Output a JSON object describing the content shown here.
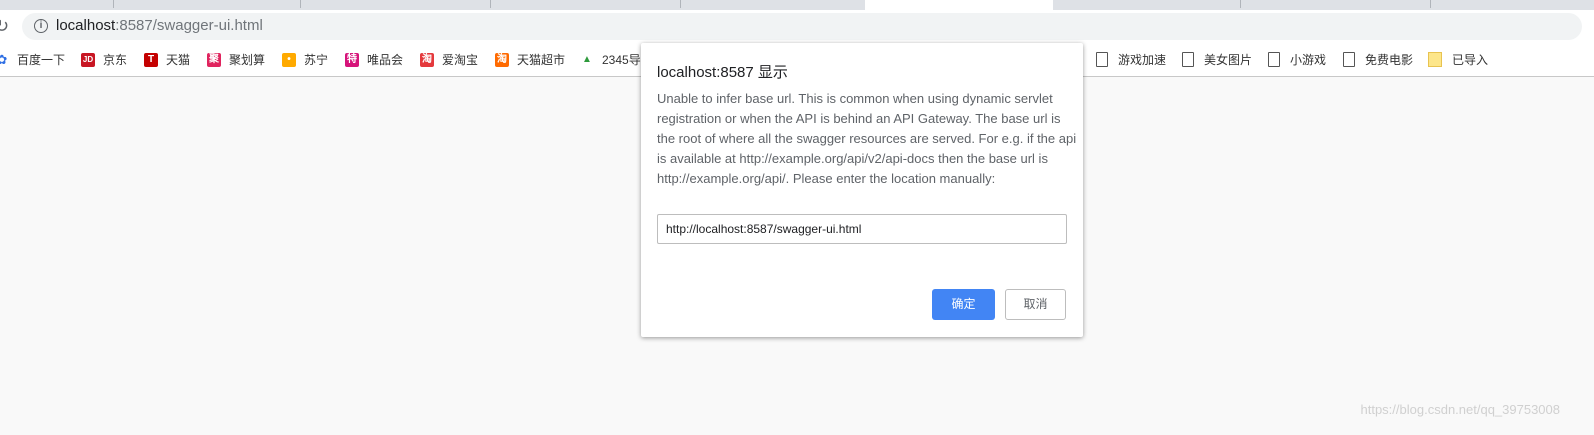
{
  "browser": {
    "url_host": "localhost",
    "url_rest": ":8587/swagger-ui.html",
    "bookmarks": [
      {
        "label": "百度一下",
        "icon": "baidu-paw-icon",
        "color": "#2f6fe4",
        "glyph": "✿"
      },
      {
        "label": "京东",
        "icon": "jd-icon",
        "color": "#c81623",
        "glyph": "JD"
      },
      {
        "label": "天猫",
        "icon": "tmall-icon",
        "color": "#c40000",
        "glyph": "T"
      },
      {
        "label": "聚划算",
        "icon": "juhuasuan-icon",
        "color": "#e0245e",
        "glyph": "聚"
      },
      {
        "label": "苏宁",
        "icon": "suning-icon",
        "color": "#ffaa00",
        "glyph": "•"
      },
      {
        "label": "唯品会",
        "icon": "vip-icon",
        "color": "#d6137a",
        "glyph": "特"
      },
      {
        "label": "爱淘宝",
        "icon": "aitaobao-icon",
        "color": "#e4393c",
        "glyph": "淘"
      },
      {
        "label": "天猫超市",
        "icon": "tmall-market-icon",
        "color": "#ff6a00",
        "glyph": "淘"
      },
      {
        "label": "2345导",
        "icon": "2345-icon",
        "color": "#2e9a3c",
        "glyph": "▲"
      }
    ],
    "bookmarks_right": [
      {
        "label": "游戏加速",
        "icon": "page-icon"
      },
      {
        "label": "美女图片",
        "icon": "page-icon"
      },
      {
        "label": "小游戏",
        "icon": "page-icon"
      },
      {
        "label": "免费电影",
        "icon": "page-icon"
      },
      {
        "label": "已导入",
        "icon": "folder-icon"
      }
    ]
  },
  "dialog": {
    "title": "localhost:8587 显示",
    "message": "Unable to infer base url. This is common when using dynamic servlet registration or when the API is behind an API Gateway. The base url is the root of where all the swagger resources are served. For e.g. if the api is available at http://example.org/api/v2/api-docs then the base url is http://example.org/api/. Please enter the location manually:",
    "input_value": "http://localhost:8587/swagger-ui.html",
    "ok_label": "确定",
    "cancel_label": "取消",
    "accent": "#4285f4"
  },
  "watermark": "https://blog.csdn.net/qq_39753008"
}
